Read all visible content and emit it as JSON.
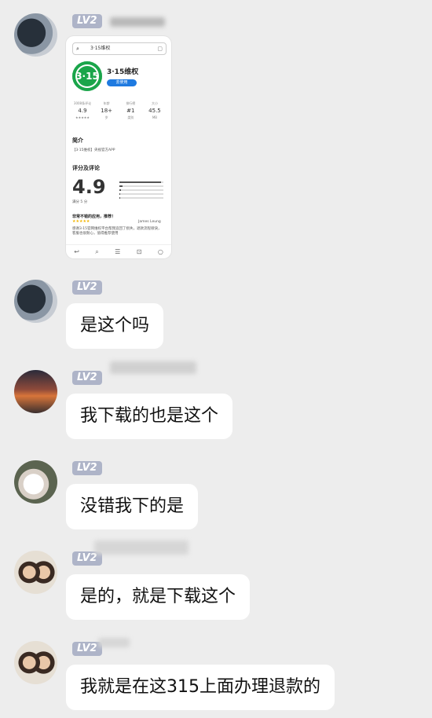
{
  "level_badge": "LV2",
  "messages": [
    {
      "kind": "image",
      "screenshot": {
        "search_query": "3·15维权",
        "app_name": "3·15维权",
        "logo_text": "3·15",
        "install_label": "去使用",
        "stats": [
          {
            "label": "3008条评论",
            "value": "4.9",
            "sub": "★★★★★"
          },
          {
            "label": "年龄",
            "value": "18+",
            "sub": "岁"
          },
          {
            "label": "排行榜",
            "value": "#1",
            "sub": "类别"
          },
          {
            "label": "大小",
            "value": "45.5",
            "sub": "MB"
          }
        ],
        "intro_title": "简介",
        "intro_text": "【3·15维权】央视官方APP",
        "ratings_title": "评分及评论",
        "rating_value": "4.9",
        "rating_sub": "满分 5 分",
        "review_title": "非常不错的应用，推荐！",
        "review_author": "James Leung",
        "review_stars": "★★★★★",
        "review_text": "感谢3·15官网维权平台帮我追回了损失，退款流程很快，客服也很耐心，值得推荐使用"
      }
    },
    {
      "kind": "text",
      "text": "是这个吗"
    },
    {
      "kind": "text",
      "text": "我下载的也是这个"
    },
    {
      "kind": "text",
      "text": "没错我下的是"
    },
    {
      "kind": "text",
      "text": "是的，就是下载这个"
    },
    {
      "kind": "text",
      "text": "我就是在这315上面办理退款的"
    }
  ],
  "colors": {
    "background": "#ededed",
    "bubble": "#ffffff",
    "badge": "#aeb4c8",
    "app_green": "#1aa54a"
  }
}
